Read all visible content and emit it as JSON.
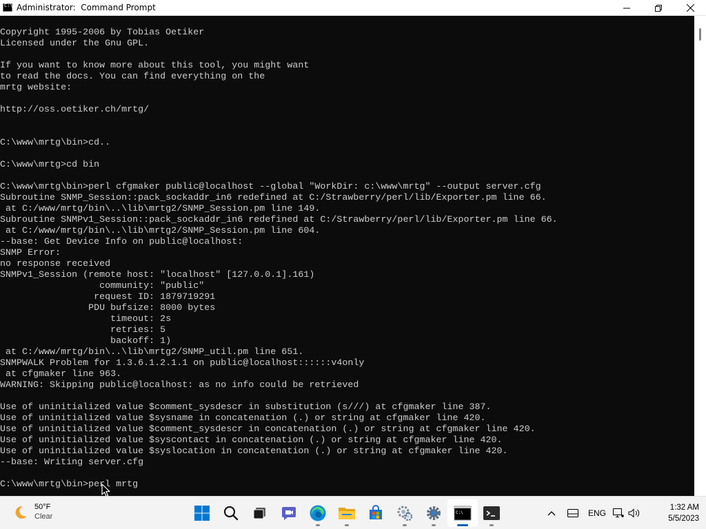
{
  "window": {
    "title": "Administrator:  Command Prompt",
    "minimize_glyph": "—",
    "maximize_glyph": "❐",
    "close_glyph": "✕"
  },
  "console": {
    "lines": [
      "Copyright 1995-2006 by Tobias Oetiker",
      "Licensed under the Gnu GPL.",
      "",
      "If you want to know more about this tool, you might want",
      "to read the docs. You can find everything on the",
      "mrtg website:",
      "",
      "http://oss.oetiker.ch/mrtg/",
      "",
      "",
      "C:\\www\\mrtg\\bin>cd..",
      "",
      "C:\\www\\mrtg>cd bin",
      "",
      "C:\\www\\mrtg\\bin>perl cfgmaker public@localhost --global \"WorkDir: c:\\www\\mrtg\" --output server.cfg",
      "Subroutine SNMP_Session::pack_sockaddr_in6 redefined at C:/Strawberry/perl/lib/Exporter.pm line 66.",
      " at C:/www/mrtg/bin\\..\\lib\\mrtg2/SNMP_Session.pm line 149.",
      "Subroutine SNMPv1_Session::pack_sockaddr_in6 redefined at C:/Strawberry/perl/lib/Exporter.pm line 66.",
      " at C:/www/mrtg/bin\\..\\lib\\mrtg2/SNMP_Session.pm line 604.",
      "--base: Get Device Info on public@localhost:",
      "SNMP Error:",
      "no response received",
      "SNMPv1_Session (remote host: \"localhost\" [127.0.0.1].161)",
      "                  community: \"public\"",
      "                 request ID: 1879719291",
      "                PDU bufsize: 8000 bytes",
      "                    timeout: 2s",
      "                    retries: 5",
      "                    backoff: 1)",
      " at C:/www/mrtg/bin\\..\\lib\\mrtg2/SNMP_util.pm line 651.",
      "SNMPWALK Problem for 1.3.6.1.2.1.1 on public@localhost::::::v4only",
      " at cfgmaker line 963.",
      "WARNING: Skipping public@localhost: as no info could be retrieved",
      "",
      "Use of uninitialized value $comment_sysdescr in substitution (s///) at cfgmaker line 387.",
      "Use of uninitialized value $sysname in concatenation (.) or string at cfgmaker line 420.",
      "Use of uninitialized value $comment_sysdescr in concatenation (.) or string at cfgmaker line 420.",
      "Use of uninitialized value $syscontact in concatenation (.) or string at cfgmaker line 420.",
      "Use of uninitialized value $syslocation in concatenation (.) or string at cfgmaker line 420.",
      "--base: Writing server.cfg",
      "",
      "C:\\www\\mrtg\\bin>perl mrtg"
    ]
  },
  "taskbar": {
    "weather": {
      "temp": "50°F",
      "desc": "Clear",
      "icon": "moon-icon"
    },
    "apps": [
      {
        "name": "start",
        "icon": "windows-logo-icon",
        "running": false,
        "active": false
      },
      {
        "name": "search",
        "icon": "search-icon",
        "running": false,
        "active": false
      },
      {
        "name": "task-view",
        "icon": "task-view-icon",
        "running": false,
        "active": false
      },
      {
        "name": "chat",
        "icon": "chat-icon",
        "running": false,
        "active": false
      },
      {
        "name": "edge",
        "icon": "edge-browser-icon",
        "running": true,
        "active": false
      },
      {
        "name": "file-explorer",
        "icon": "folder-icon",
        "running": true,
        "active": false
      },
      {
        "name": "store",
        "icon": "store-icon",
        "running": false,
        "active": false
      },
      {
        "name": "control-panel",
        "icon": "control-panel-icon",
        "running": true,
        "active": false
      },
      {
        "name": "settings",
        "icon": "gear-icon",
        "running": true,
        "active": false
      },
      {
        "name": "command-prompt",
        "icon": "command-prompt-icon",
        "running": true,
        "active": true
      },
      {
        "name": "terminal",
        "icon": "terminal-icon",
        "running": true,
        "active": false
      }
    ],
    "tray": {
      "lang": "ENG",
      "time": "1:32 AM",
      "date": "5/5/2023"
    }
  }
}
